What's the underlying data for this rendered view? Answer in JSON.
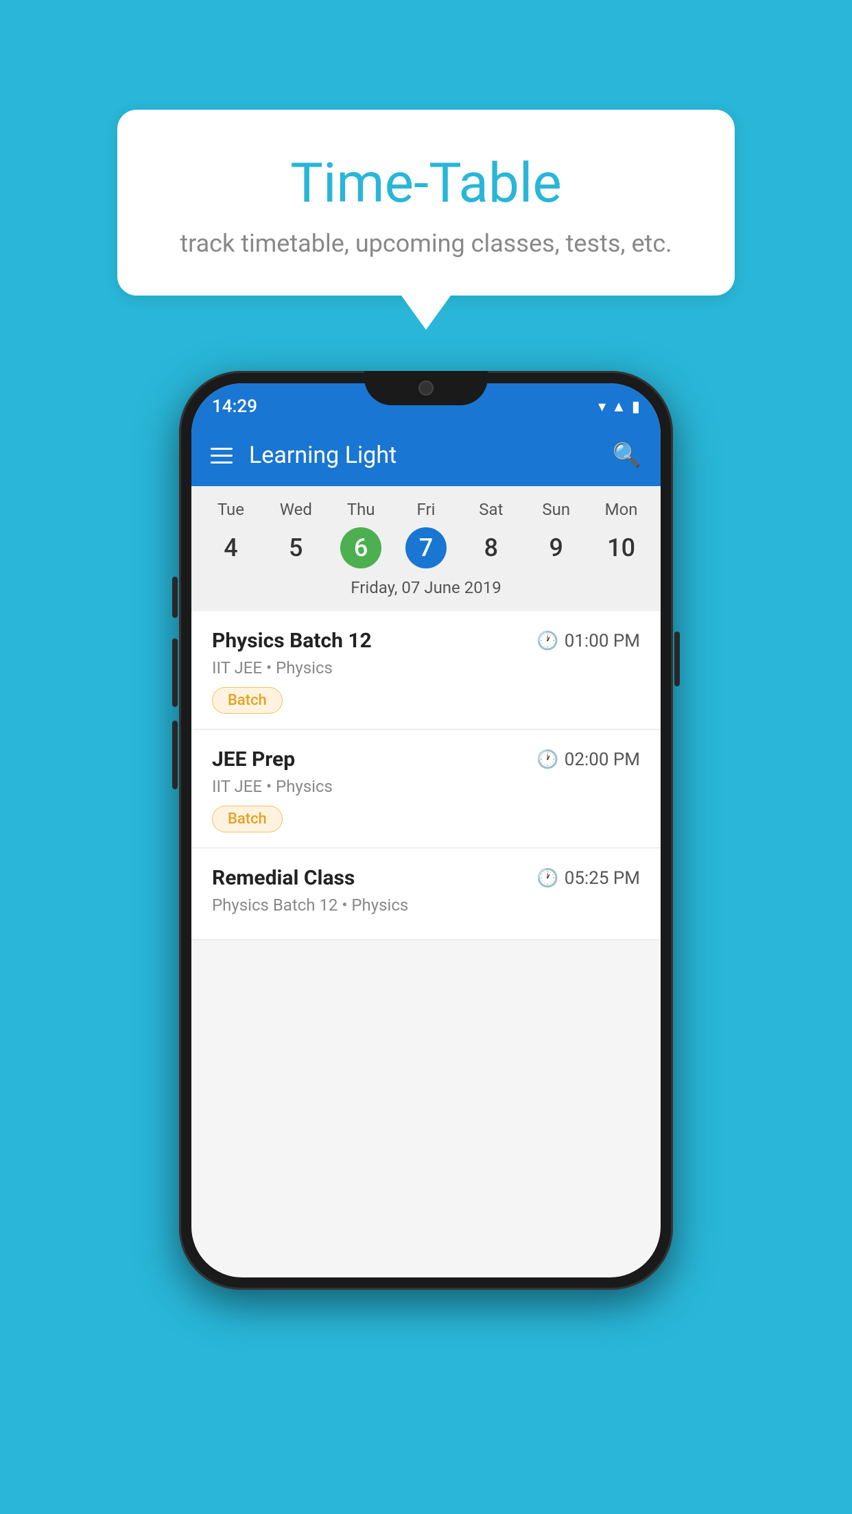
{
  "background_color": "#29b6d8",
  "tooltip": {
    "title": "Time-Table",
    "subtitle": "track timetable, upcoming classes, tests, etc."
  },
  "phone": {
    "status_bar": {
      "time": "14:29"
    },
    "app_bar": {
      "title": "Learning Light"
    },
    "calendar": {
      "days": [
        {
          "name": "Tue",
          "num": "4",
          "state": "normal"
        },
        {
          "name": "Wed",
          "num": "5",
          "state": "normal"
        },
        {
          "name": "Thu",
          "num": "6",
          "state": "today"
        },
        {
          "name": "Fri",
          "num": "7",
          "state": "selected"
        },
        {
          "name": "Sat",
          "num": "8",
          "state": "normal"
        },
        {
          "name": "Sun",
          "num": "9",
          "state": "normal"
        },
        {
          "name": "Mon",
          "num": "10",
          "state": "normal"
        }
      ],
      "selected_date_label": "Friday, 07 June 2019"
    },
    "schedule": [
      {
        "title": "Physics Batch 12",
        "time": "01:00 PM",
        "meta": "IIT JEE • Physics",
        "badge": "Batch"
      },
      {
        "title": "JEE Prep",
        "time": "02:00 PM",
        "meta": "IIT JEE • Physics",
        "badge": "Batch"
      },
      {
        "title": "Remedial Class",
        "time": "05:25 PM",
        "meta": "Physics Batch 12 • Physics",
        "badge": null
      }
    ]
  }
}
